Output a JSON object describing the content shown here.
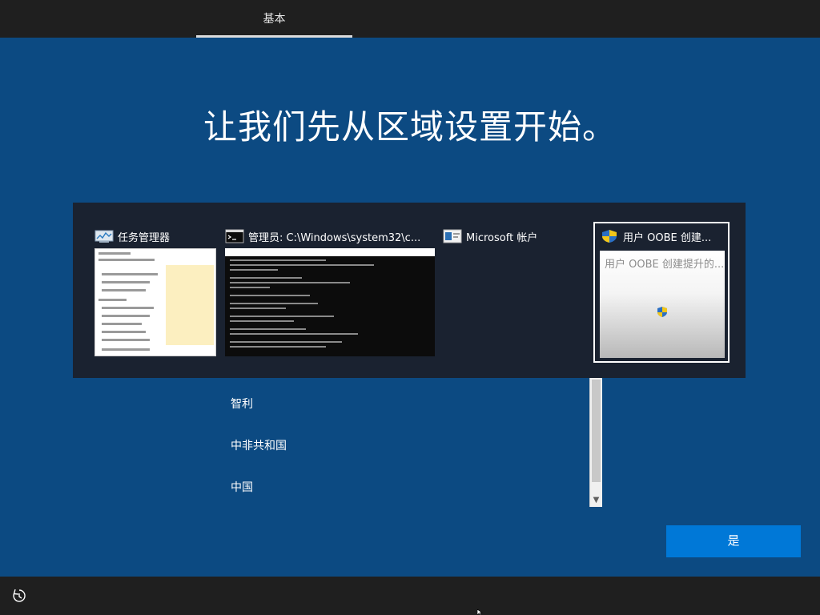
{
  "header": {
    "tab_label": "基本"
  },
  "main": {
    "headline": "让我们先从区域设置开始。",
    "region_list": {
      "items": [
        "智利",
        "中非共和国",
        "中国"
      ]
    },
    "yes_label": "是"
  },
  "task_switcher": {
    "windows": [
      {
        "title": "任务管理器",
        "icon": "task-manager-icon"
      },
      {
        "title": "管理员: C:\\Windows\\system32\\c...",
        "icon": "command-prompt-icon"
      },
      {
        "title": "Microsoft 帐户",
        "icon": "microsoft-account-icon"
      },
      {
        "title": "用户 OOBE 创建...",
        "icon": "uac-shield-icon",
        "thumb_text": "用户 OOBE 创建提升的..."
      }
    ]
  },
  "colors": {
    "background": "#0c4a82",
    "bar": "#1f1f1f",
    "accent_button": "#0078d7",
    "switcher": "#1a2230"
  }
}
